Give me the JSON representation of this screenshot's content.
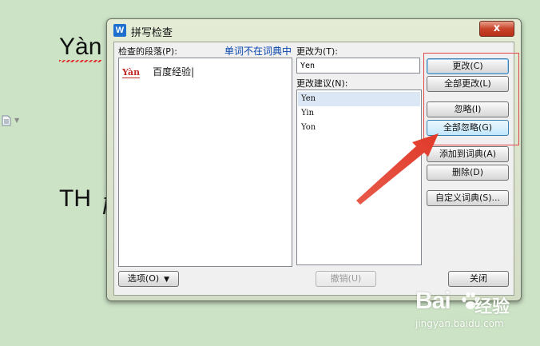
{
  "document": {
    "word1": "Yàn",
    "word2": "TH",
    "word2_tail": "ƒ"
  },
  "dialog": {
    "title": "拼写检查",
    "logo_letter": "W",
    "close_label": "x",
    "paragraph_label": "检查的段落(P):",
    "not_in_dict_label": "单词不在词典中",
    "paragraph": {
      "word": "Yàn",
      "context": "百度经验|"
    },
    "change_to_label": "更改为(T):",
    "change_to_value": "Yen",
    "suggestions_label": "更改建议(N):",
    "suggestions": [
      "Yen",
      "Yin",
      "Yon"
    ],
    "selected_suggestion": "Yen",
    "buttons": {
      "change": "更改(C)",
      "change_all": "全部更改(L)",
      "ignore": "忽略(I)",
      "ignore_all": "全部忽略(G)",
      "add_to_dict": "添加到词典(A)",
      "delete": "删除(D)",
      "custom_dict": "自定义词典(S)...",
      "options": "选项(O)",
      "undo": "撤销(U)",
      "close": "关闭"
    }
  },
  "watermark": {
    "brand": "Bai",
    "cn": "经验",
    "sub": "jingyan.baidu.com"
  },
  "colors": {
    "background": "#cce3c6",
    "accent_red": "#e04848",
    "misspelled": "#c0282a",
    "link_blue": "#0645ad",
    "selection": "#dce7f5"
  }
}
